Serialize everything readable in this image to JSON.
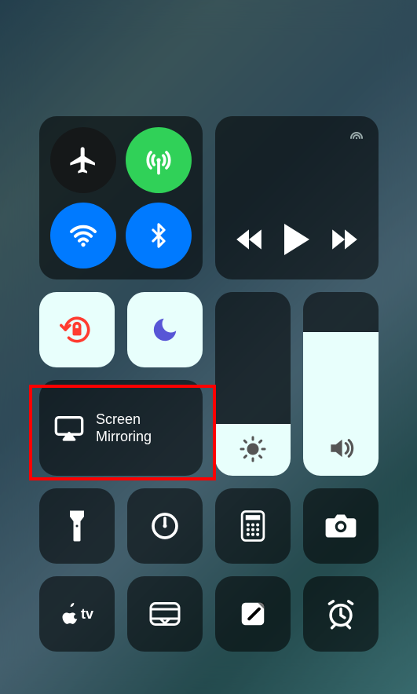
{
  "connectivity": {
    "airplane": {
      "name": "airplane-mode",
      "active": false
    },
    "cellular": {
      "name": "cellular-data",
      "active": true
    },
    "wifi": {
      "name": "wifi",
      "active": true
    },
    "bluetooth": {
      "name": "bluetooth",
      "active": true
    }
  },
  "media": {
    "airplay_indicator": "airplay",
    "controls": {
      "prev": "previous-track",
      "play": "play",
      "next": "next-track"
    }
  },
  "toggles": {
    "orientation_lock": {
      "active": true
    },
    "dnd": {
      "active": true
    },
    "screen_mirroring": {
      "label_line1": "Screen",
      "label_line2": "Mirroring"
    }
  },
  "sliders": {
    "brightness": {
      "value_pct": 28
    },
    "volume": {
      "value_pct": 78
    }
  },
  "shortcuts": {
    "row1": [
      "flashlight",
      "timer",
      "calculator",
      "camera"
    ],
    "row2": [
      "apple-tv",
      "wallet",
      "notes",
      "alarm"
    ]
  },
  "appletv_label": "tv",
  "highlight": {
    "target": "screen-mirroring"
  },
  "colors": {
    "green": "#30d158",
    "blue": "#007aff",
    "red": "#ff3b30",
    "purple": "#5856d6",
    "light": "#e8fffc"
  }
}
